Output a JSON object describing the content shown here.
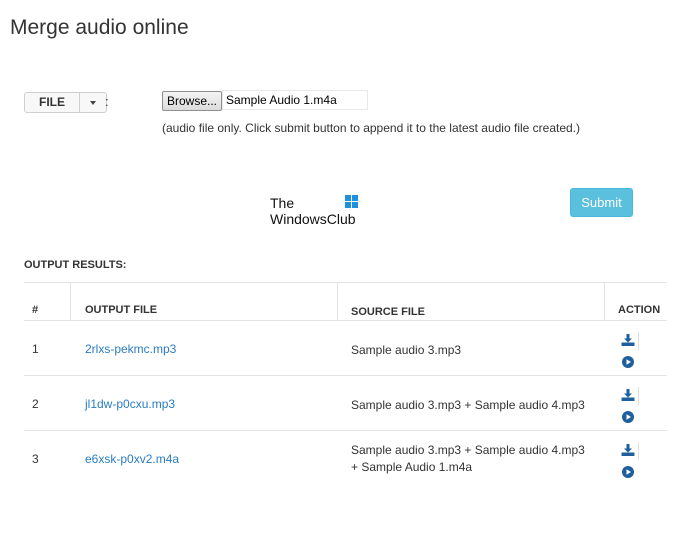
{
  "page": {
    "title": "Merge audio online"
  },
  "file_input": {
    "type_button_label": "FILE",
    "separator": ":",
    "browse_label": "Browse...",
    "selected_file": "Sample Audio 1.m4a",
    "hint": "(audio file only. Click submit button to append it to the latest audio file created.)"
  },
  "watermark": {
    "line1": "The",
    "line2": "WindowsClub"
  },
  "submit": {
    "label": "Submit"
  },
  "output": {
    "title": "OUTPUT RESULTS:",
    "columns": [
      "#",
      "OUTPUT FILE",
      "SOURCE FILE",
      "ACTION"
    ],
    "rows": [
      {
        "num": "1",
        "output_file": "2rlxs-pekmc.mp3",
        "source_line1": "Sample audio 3.mp3",
        "source_line2": ""
      },
      {
        "num": "2",
        "output_file": "jl1dw-p0cxu.mp3",
        "source_line1": "Sample audio 3.mp3 + Sample audio 4.mp3",
        "source_line2": ""
      },
      {
        "num": "3",
        "output_file": "e6xsk-p0xv2.m4a",
        "source_line1": "Sample audio 3.mp3 + Sample audio 4.mp3",
        "source_line2": "+ Sample Audio 1.m4a"
      }
    ]
  },
  "icons": {
    "download": "download-icon",
    "play": "play-circle-icon"
  },
  "colors": {
    "link": "#2a7dbf",
    "submit": "#5bc0de",
    "icon": "#1f5f9e"
  }
}
